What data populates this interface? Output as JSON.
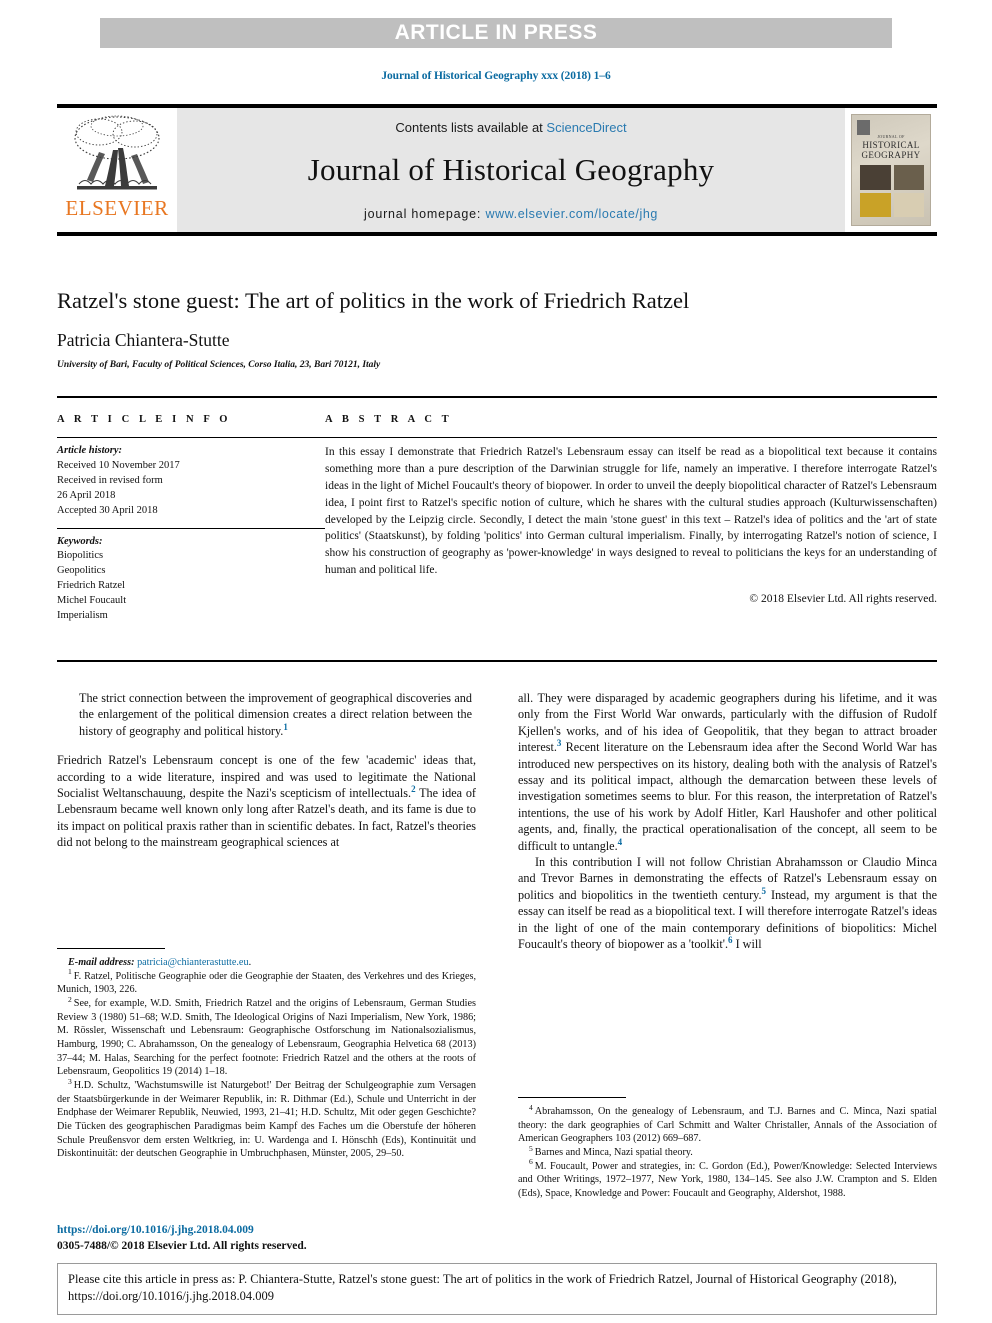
{
  "banner": {
    "label": "ARTICLE IN PRESS"
  },
  "running_head": {
    "text": "Journal of Historical Geography xxx (2018) 1–6"
  },
  "masthead": {
    "publisher_logo": "ELSEVIER",
    "contents_prefix": "Contents lists available at ",
    "contents_link": "ScienceDirect",
    "journal_name": "Journal of Historical Geography",
    "homepage_prefix": "journal homepage: ",
    "homepage_link": "www.elsevier.com/locate/jhg",
    "cover": {
      "line1": "JOURNAL OF",
      "line2": "HISTORICAL GEOGRAPHY"
    }
  },
  "article": {
    "title": "Ratzel's stone guest: The art of politics in the work of Friedrich Ratzel",
    "author": "Patricia Chiantera-Stutte",
    "affiliation": "University of Bari, Faculty of Political Sciences, Corso Italia, 23, Bari 70121, Italy"
  },
  "info": {
    "heading": "A R T I C L E   I N F O",
    "history_label": "Article history:",
    "history": [
      "Received 10 November 2017",
      "Received in revised form",
      "26 April 2018",
      "Accepted 30 April 2018"
    ],
    "keywords_label": "Keywords:",
    "keywords": [
      "Biopolitics",
      "Geopolitics",
      "Friedrich Ratzel",
      "Michel Foucault",
      "Imperialism"
    ]
  },
  "abstract": {
    "heading": "A B S T R A C T",
    "text": "In this essay I demonstrate that Friedrich Ratzel's Lebensraum essay can itself be read as a biopolitical text because it contains something more than a pure description of the Darwinian struggle for life, namely an imperative. I therefore interrogate Ratzel's ideas in the light of Michel Foucault's theory of biopower. In order to unveil the deeply biopolitical character of Ratzel's Lebensraum idea, I point first to Ratzel's specific notion of culture, which he shares with the cultural studies approach (Kulturwissenschaften) developed by the Leipzig circle. Secondly, I detect the main 'stone guest' in this text – Ratzel's idea of politics and the 'art of state politics' (Staatskunst), by folding 'politics' into German cultural imperialism. Finally, by interrogating Ratzel's notion of science, I show his construction of geography as 'power-knowledge' in ways designed to reveal to politicians the keys for an understanding of human and political life.",
    "copyright": "© 2018 Elsevier Ltd. All rights reserved."
  },
  "body": {
    "left": {
      "epigraph": "The strict connection between the improvement of geographical discoveries and the enlargement of the political dimension creates a direct relation between the history of geography and political history.",
      "epigraph_note": "1",
      "para1_a": "Friedrich Ratzel's Lebensraum concept is one of the few 'academic' ideas that, according to a wide literature, inspired and was used to legitimate the National Socialist Weltanschauung, despite the Nazi's scepticism of intellectuals.",
      "para1_note": "2",
      "para1_b": " The idea of Lebensraum became well known only long after Ratzel's death, and its fame is due to its impact on political praxis rather than in scientific debates. In fact, Ratzel's theories did not belong to the mainstream geographical sciences at"
    },
    "right": {
      "para_a": "all. They were disparaged by academic geographers during his lifetime, and it was only from the First World War onwards, particularly with the diffusion of Rudolf Kjellen's works, and of his idea of Geopolitik, that they began to attract broader interest.",
      "note_3": "3",
      "para_b": " Recent literature on the Lebensraum idea after the Second World War has introduced new perspectives on its history, dealing both with the analysis of Ratzel's essay and its political impact, although the demarcation between these levels of investigation sometimes seems to blur. For this reason, the interpretation of Ratzel's intentions, the use of his work by Adolf Hitler, Karl Haushofer and other political agents, and, finally, the practical operationalisation of the concept, all seem to be difficult to untangle.",
      "note_4": "4",
      "para2_a": "In this contribution I will not follow Christian Abrahamsson or Claudio Minca and Trevor Barnes in demonstrating the effects of Ratzel's Lebensraum essay on politics and biopolitics in the twentieth century.",
      "note_5": "5",
      "para2_b": " Instead, my argument is that the essay can itself be read as a biopolitical text. I will therefore interrogate Ratzel's ideas in the light of one of the main contemporary definitions of biopolitics: Michel Foucault's theory of biopower as a 'toolkit'.",
      "note_6": "6",
      "para2_c": " I will"
    }
  },
  "footnotes": {
    "left": [
      {
        "marker": "",
        "label": "E-mail address:",
        "link": "patricia@chianterastutte.eu",
        "tail": "."
      },
      {
        "marker": "1",
        "text": "F. Ratzel, Politische Geographie oder die Geographie der Staaten, des Verkehres und des Krieges, Munich, 1903, 226."
      },
      {
        "marker": "2",
        "text": "See, for example, W.D. Smith, Friedrich Ratzel and the origins of Lebensraum, German Studies Review 3 (1980) 51–68; W.D. Smith, The Ideological Origins of Nazi Imperialism, New York, 1986; M. Rössler, Wissenschaft und Lebensraum: Geographische Ostforschung im Nationalsozialismus, Hamburg, 1990; C. Abrahamsson, On the genealogy of Lebensraum, Geographia Helvetica 68 (2013) 37–44; M. Halas, Searching for the perfect footnote: Friedrich Ratzel and the others at the roots of Lebensraum, Geopolitics 19 (2014) 1–18."
      },
      {
        "marker": "3",
        "text": "H.D. Schultz, 'Wachstumswille ist Naturgebot!' Der Beitrag der Schulgeographie zum Versagen der Staatsbürgerkunde in der Weimarer Republik, in: R. Dithmar (Ed.), Schule und Unterricht in der Endphase der Weimarer Republik, Neuwied, 1993, 21–41; H.D. Schultz, Mit oder gegen Geschichte? Die Tücken des geographischen Paradigmas beim Kampf des Faches um die Oberstufe der höheren Schule Preußensvor dem ersten Weltkrieg, in: U. Wardenga and I. Hönschh (Eds), Kontinuität und Diskontinuität: der deutschen Geographie in Umbruchphasen, Münster, 2005, 29–50."
      }
    ],
    "right": [
      {
        "marker": "4",
        "text": "Abrahamsson, On the genealogy of Lebensraum, and T.J. Barnes and C. Minca, Nazi spatial theory: the dark geographies of Carl Schmitt and Walter Christaller, Annals of the Association of American Geographers 103 (2012) 669–687."
      },
      {
        "marker": "5",
        "text": "Barnes and Minca, Nazi spatial theory."
      },
      {
        "marker": "6",
        "text": "M. Foucault, Power and strategies, in: C. Gordon (Ed.), Power/Knowledge: Selected Interviews and Other Writings, 1972–1977, New York, 1980, 134–145. See also J.W. Crampton and S. Elden (Eds), Space, Knowledge and Power: Foucault and Geography, Aldershot, 1988."
      }
    ]
  },
  "footer": {
    "doi": "https://doi.org/10.1016/j.jhg.2018.04.009",
    "issn": "0305-7488/© 2018 Elsevier Ltd. All rights reserved."
  },
  "cite_box": {
    "text": "Please cite this article in press as: P. Chiantera-Stutte, Ratzel's stone guest: The art of politics in the work of Friedrich Ratzel, Journal of Historical Geography (2018), https://doi.org/10.1016/j.jhg.2018.04.009"
  },
  "colors": {
    "link_blue": "#0b6ba1",
    "elsevier_orange": "#e87722",
    "banner_gray": "#bfbfbf",
    "masthead_gray": "#e6e6e6"
  }
}
